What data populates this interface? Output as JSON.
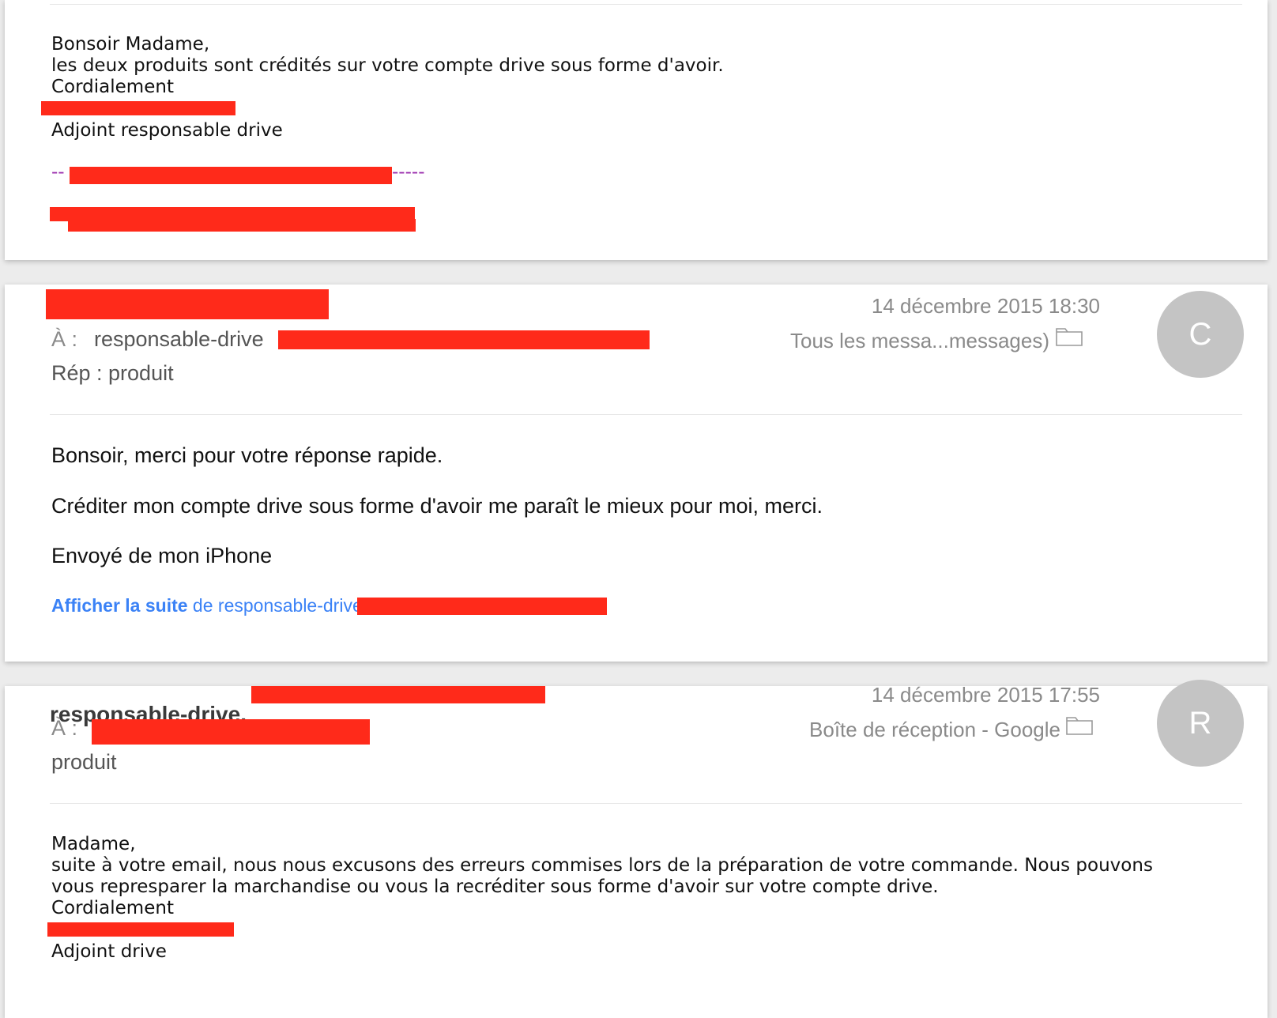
{
  "email_top": {
    "body_lines": [
      "Bonsoir Madame,",
      "les deux produits sont crédités sur votre compte drive sous forme d'avoir.",
      "Cordialement"
    ],
    "signature_title": "Adjoint responsable drive",
    "separator_dashes_left": "--",
    "separator_dashes_right": "-----"
  },
  "email_middle": {
    "to_label": "À :",
    "to_value": "responsable-drive",
    "subject": "Rép : produit",
    "date": "14 décembre 2015 18:30",
    "mailbox": "Tous les messa...messages)",
    "avatar_letter": "C",
    "body_paragraphs": [
      "Bonsoir, merci pour votre réponse rapide.",
      "Créditer mon compte drive sous forme d'avoir me paraît le mieux pour moi, merci.",
      "Envoyé de mon iPhone"
    ],
    "show_more_bold": "Afficher la suite",
    "show_more_rest": " de responsable-drive"
  },
  "email_bottom": {
    "sender": "responsable-drive.",
    "to_label": "À :",
    "subject": "produit",
    "date": "14 décembre 2015 17:55",
    "mailbox": "Boîte de réception - Google",
    "avatar_letter": "R",
    "body_lines": [
      "Madame,",
      "suite à votre email, nous nous excusons des erreurs commises lors de la préparation de votre commande. Nous pouvons",
      "vous represparer la marchandise ou vous la recréditer sous forme d'avoir sur votre compte drive.",
      "Cordialement"
    ],
    "signature_title": "Adjoint drive"
  },
  "colors": {
    "redaction": "#ff2a1a",
    "link": "#3b82f6",
    "avatar": "#c4c4c4",
    "separator": "#9b2fae"
  }
}
